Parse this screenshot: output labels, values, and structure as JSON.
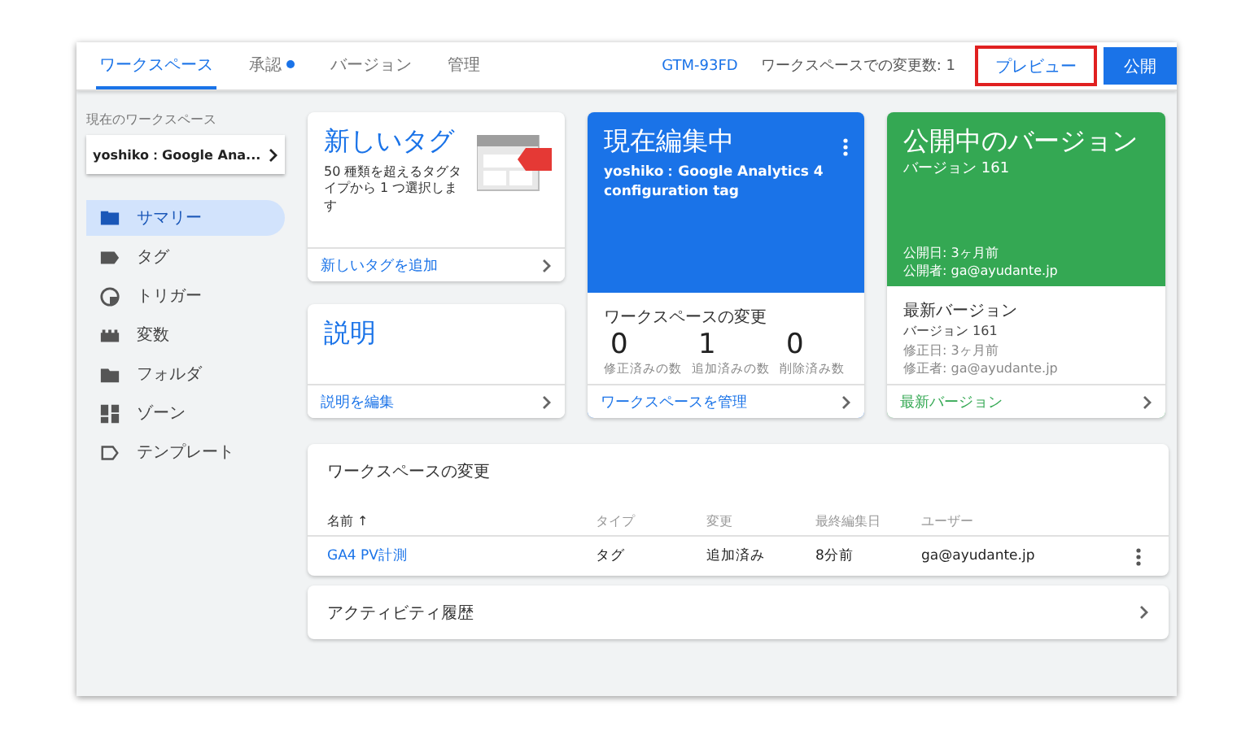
{
  "tabs": [
    {
      "label": "ワークスペース",
      "selected": true,
      "dot": false
    },
    {
      "label": "承認",
      "selected": false,
      "dot": true
    },
    {
      "label": "バージョン",
      "selected": false,
      "dot": false
    },
    {
      "label": "管理",
      "selected": false,
      "dot": false
    }
  ],
  "container_id": "GTM-93FD",
  "change_count": "ワークスペースでの変更数: 1",
  "preview_button": {
    "label": "プレビュー",
    "highlighted": true
  },
  "publish_button": "公開",
  "sidebar": {
    "workspace_label": "現在のワークスペース",
    "workspace": "yoshiko：Google Ana...",
    "items": [
      {
        "label": "サマリー",
        "selected": true
      },
      {
        "label": "タグ",
        "selected": false
      },
      {
        "label": "トリガー",
        "selected": false
      },
      {
        "label": "変数",
        "selected": false
      },
      {
        "label": "フォルダ",
        "selected": false
      },
      {
        "label": "ゾーン",
        "selected": false
      },
      {
        "label": "テンプレート",
        "selected": false
      }
    ]
  },
  "new_tag_card": {
    "title": "新しいタグ",
    "description": "50 種類を超えるタグタイプから 1 つ選択します",
    "link": "新しいタグを追加"
  },
  "description_card": {
    "title": "説明",
    "link": "説明を編集"
  },
  "editing_card": {
    "title": "現在編集中",
    "subtitle": "yoshiko：Google Analytics 4 configuration tag",
    "section": "ワークスペースの変更",
    "stats": [
      {
        "value": "0",
        "label": "修正済みの数"
      },
      {
        "value": "1",
        "label": "追加済みの数"
      },
      {
        "value": "0",
        "label": "削除済み数"
      }
    ],
    "link": "ワークスペースを管理"
  },
  "published_card": {
    "title": "公開中のバージョン",
    "version": "バージョン 161",
    "published_date": "公開日: 3ヶ月前",
    "publisher": "公開者: ga@ayudante.jp",
    "section": "最新バージョン",
    "latest_version": "バージョン 161",
    "modified_date": "修正日: 3ヶ月前",
    "modifier": "修正者: ga@ayudante.jp",
    "link": "最新バージョン"
  },
  "changes": {
    "title": "ワークスペースの変更",
    "columns": [
      "名前 ↑",
      "タイプ",
      "変更",
      "最終編集日",
      "ユーザー"
    ],
    "rows": [
      [
        "GA4 PV計測",
        "タグ",
        "追加済み",
        "8分前",
        "ga@ayudante.jp"
      ]
    ]
  },
  "activity": {
    "title": "アクティビティ履歴"
  }
}
